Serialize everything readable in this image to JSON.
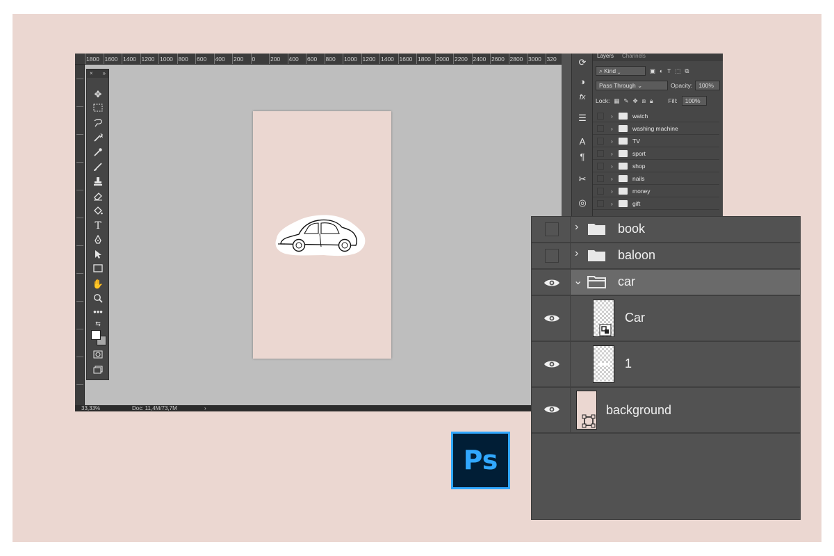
{
  "ruler": {
    "top_ticks": [
      "1800",
      "1600",
      "1400",
      "1200",
      "1000",
      "800",
      "600",
      "400",
      "200",
      "0",
      "200",
      "400",
      "600",
      "800",
      "1000",
      "1200",
      "1400",
      "1600",
      "1800",
      "2000",
      "2200",
      "2400",
      "2600",
      "2800",
      "3000",
      "320"
    ]
  },
  "status": {
    "zoom": "33,33%",
    "doc": "Doc: 11,4M/73,7M",
    "arrow": "›"
  },
  "toolbar": {
    "close": "×",
    "collapse": "»"
  },
  "layers_panel_small": {
    "tabs": [
      "Layers",
      "Channels"
    ],
    "kind_label": "Kind",
    "blend_mode": "Pass Through",
    "opacity_label": "Opacity:",
    "opacity_value": "100%",
    "lock_label": "Lock:",
    "fill_label": "Fill:",
    "fill_value": "100%",
    "layers": [
      "watch",
      "washing machine",
      "TV",
      "sport",
      "shop",
      "nails",
      "money",
      "gift"
    ]
  },
  "layers_panel_big": {
    "layers": [
      {
        "name": "book",
        "type": "group",
        "visible": false,
        "expanded": false
      },
      {
        "name": "baloon",
        "type": "group",
        "visible": false,
        "expanded": false
      },
      {
        "name": "car",
        "type": "group",
        "visible": true,
        "expanded": true
      },
      {
        "name": "Car",
        "type": "smart-object",
        "visible": true
      },
      {
        "name": "1",
        "type": "layer",
        "visible": true
      },
      {
        "name": "background",
        "type": "layer",
        "visible": true
      }
    ]
  },
  "logo": {
    "text": "Ps"
  },
  "colors": {
    "backdrop": "#ebd7d1",
    "panel": "#525252",
    "ps_blue": "#31a8ff",
    "ps_navy": "#011e36"
  }
}
